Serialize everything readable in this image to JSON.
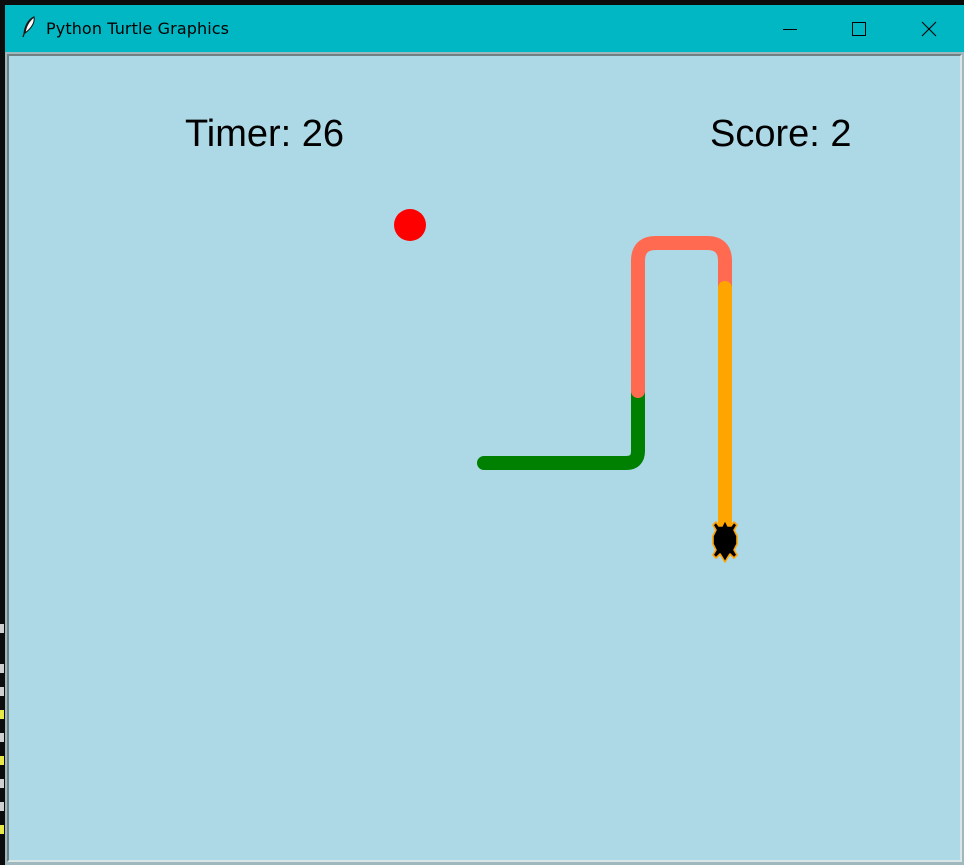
{
  "window": {
    "title": "Python Turtle Graphics",
    "icon": "feather-icon",
    "controls": {
      "minimize_icon": "minimize-icon",
      "maximize_icon": "maximize-icon",
      "close_icon": "close-icon"
    }
  },
  "hud": {
    "timer_text": "Timer: 26",
    "score_text": "Score: 2"
  },
  "game": {
    "background_color": "#add8e6",
    "food_color": "#ff0000",
    "turtle_color": "#000000",
    "turtle_outline_color": "#ffa500",
    "trail_colors": [
      "#008000",
      "#ff6a50",
      "#ffa500"
    ]
  },
  "colors": {
    "titlebar": "#00b7c3"
  }
}
